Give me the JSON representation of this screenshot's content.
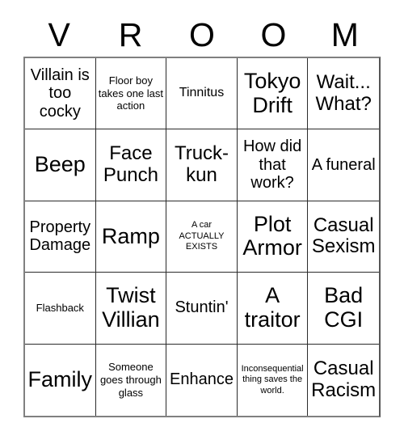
{
  "card": {
    "header_letters": [
      "V",
      "R",
      "O",
      "O",
      "M"
    ],
    "columns": 5,
    "rows": 5,
    "border_color": "#2b2b2b",
    "outer_border_color": "#808080",
    "background_color": "#ffffff",
    "text_color": "#000000",
    "cells": [
      {
        "text": "Villain is too cocky",
        "size": "lg"
      },
      {
        "text": "Floor boy takes one last action",
        "size": "sm"
      },
      {
        "text": "Tinnitus",
        "size": "md"
      },
      {
        "text": "Tokyo Drift",
        "size": "xxl"
      },
      {
        "text": "Wait... What?",
        "size": "xl"
      },
      {
        "text": "Beep",
        "size": "xxl"
      },
      {
        "text": "Face Punch",
        "size": "xl"
      },
      {
        "text": "Truck-kun",
        "size": "xl"
      },
      {
        "text": "How did that work?",
        "size": "lg"
      },
      {
        "text": "A funeral",
        "size": "lg"
      },
      {
        "text": "Property Damage",
        "size": "lg"
      },
      {
        "text": "Ramp",
        "size": "xxl"
      },
      {
        "text": "A car ACTUALLY EXISTS",
        "size": "xs"
      },
      {
        "text": "Plot Armor",
        "size": "xxl"
      },
      {
        "text": "Casual Sexism",
        "size": "xl"
      },
      {
        "text": "Flashback",
        "size": "sm"
      },
      {
        "text": "Twist Villian",
        "size": "xxl"
      },
      {
        "text": "Stuntin'",
        "size": "lg"
      },
      {
        "text": "A traitor",
        "size": "xxl"
      },
      {
        "text": "Bad CGI",
        "size": "xxl"
      },
      {
        "text": "Family",
        "size": "xxl"
      },
      {
        "text": "Someone goes through glass",
        "size": "sm"
      },
      {
        "text": "Enhance",
        "size": "lg"
      },
      {
        "text": "Inconsequential thing saves the world.",
        "size": "xs"
      },
      {
        "text": "Casual Racism",
        "size": "xl"
      }
    ]
  }
}
